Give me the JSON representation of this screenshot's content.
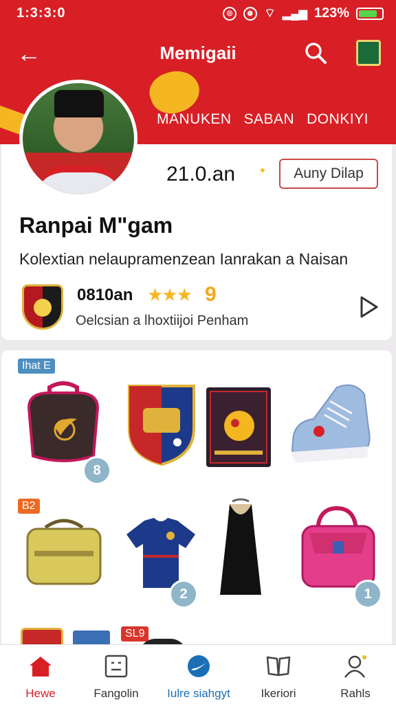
{
  "status_bar": {
    "time": "1:3:3:0",
    "battery_text": "123%",
    "battery_level": 0.8,
    "battery_color": "#54d64d"
  },
  "header": {
    "title": "Memigaii",
    "tabs": [
      "MANUKEN",
      "SABAN",
      "DONKIYI"
    ],
    "brand_color": "#d81f26",
    "accent_color": "#f4b721"
  },
  "profile": {
    "followers": "21.0.an",
    "follow_button": "Auny Dilap",
    "name": "Ranpai M\"gam",
    "description": "Kolextian nelaupramenzean Ianrakan a Naisan",
    "rating_label": "0810an",
    "stars": 3,
    "rating_count": "9",
    "sub_description": "Oelcsian a lhoxtiijoi Penham"
  },
  "grid": {
    "tags": [
      "Ihat E",
      "B2",
      "SL9"
    ],
    "badges": [
      "8",
      "2",
      "1"
    ],
    "items": [
      {
        "name": "backpack-icon"
      },
      {
        "name": "jersey-crest-icon"
      },
      {
        "name": "boxed-ball-icon"
      },
      {
        "name": "sneaker-icon"
      },
      {
        "name": "duffel-bag-icon"
      },
      {
        "name": "football-shirt-icon"
      },
      {
        "name": "dress-icon"
      },
      {
        "name": "pink-bag-icon"
      }
    ]
  },
  "bottom_nav": {
    "items": [
      {
        "label": "Hewe",
        "icon": "home-icon"
      },
      {
        "label": "Fangolin",
        "icon": "grid-icon"
      },
      {
        "label": "Iulre siahgyt",
        "icon": "nike-swoosh-icon"
      },
      {
        "label": "Ikeriori",
        "icon": "book-icon"
      },
      {
        "label": "Rahls",
        "icon": "profile-icon"
      }
    ]
  }
}
